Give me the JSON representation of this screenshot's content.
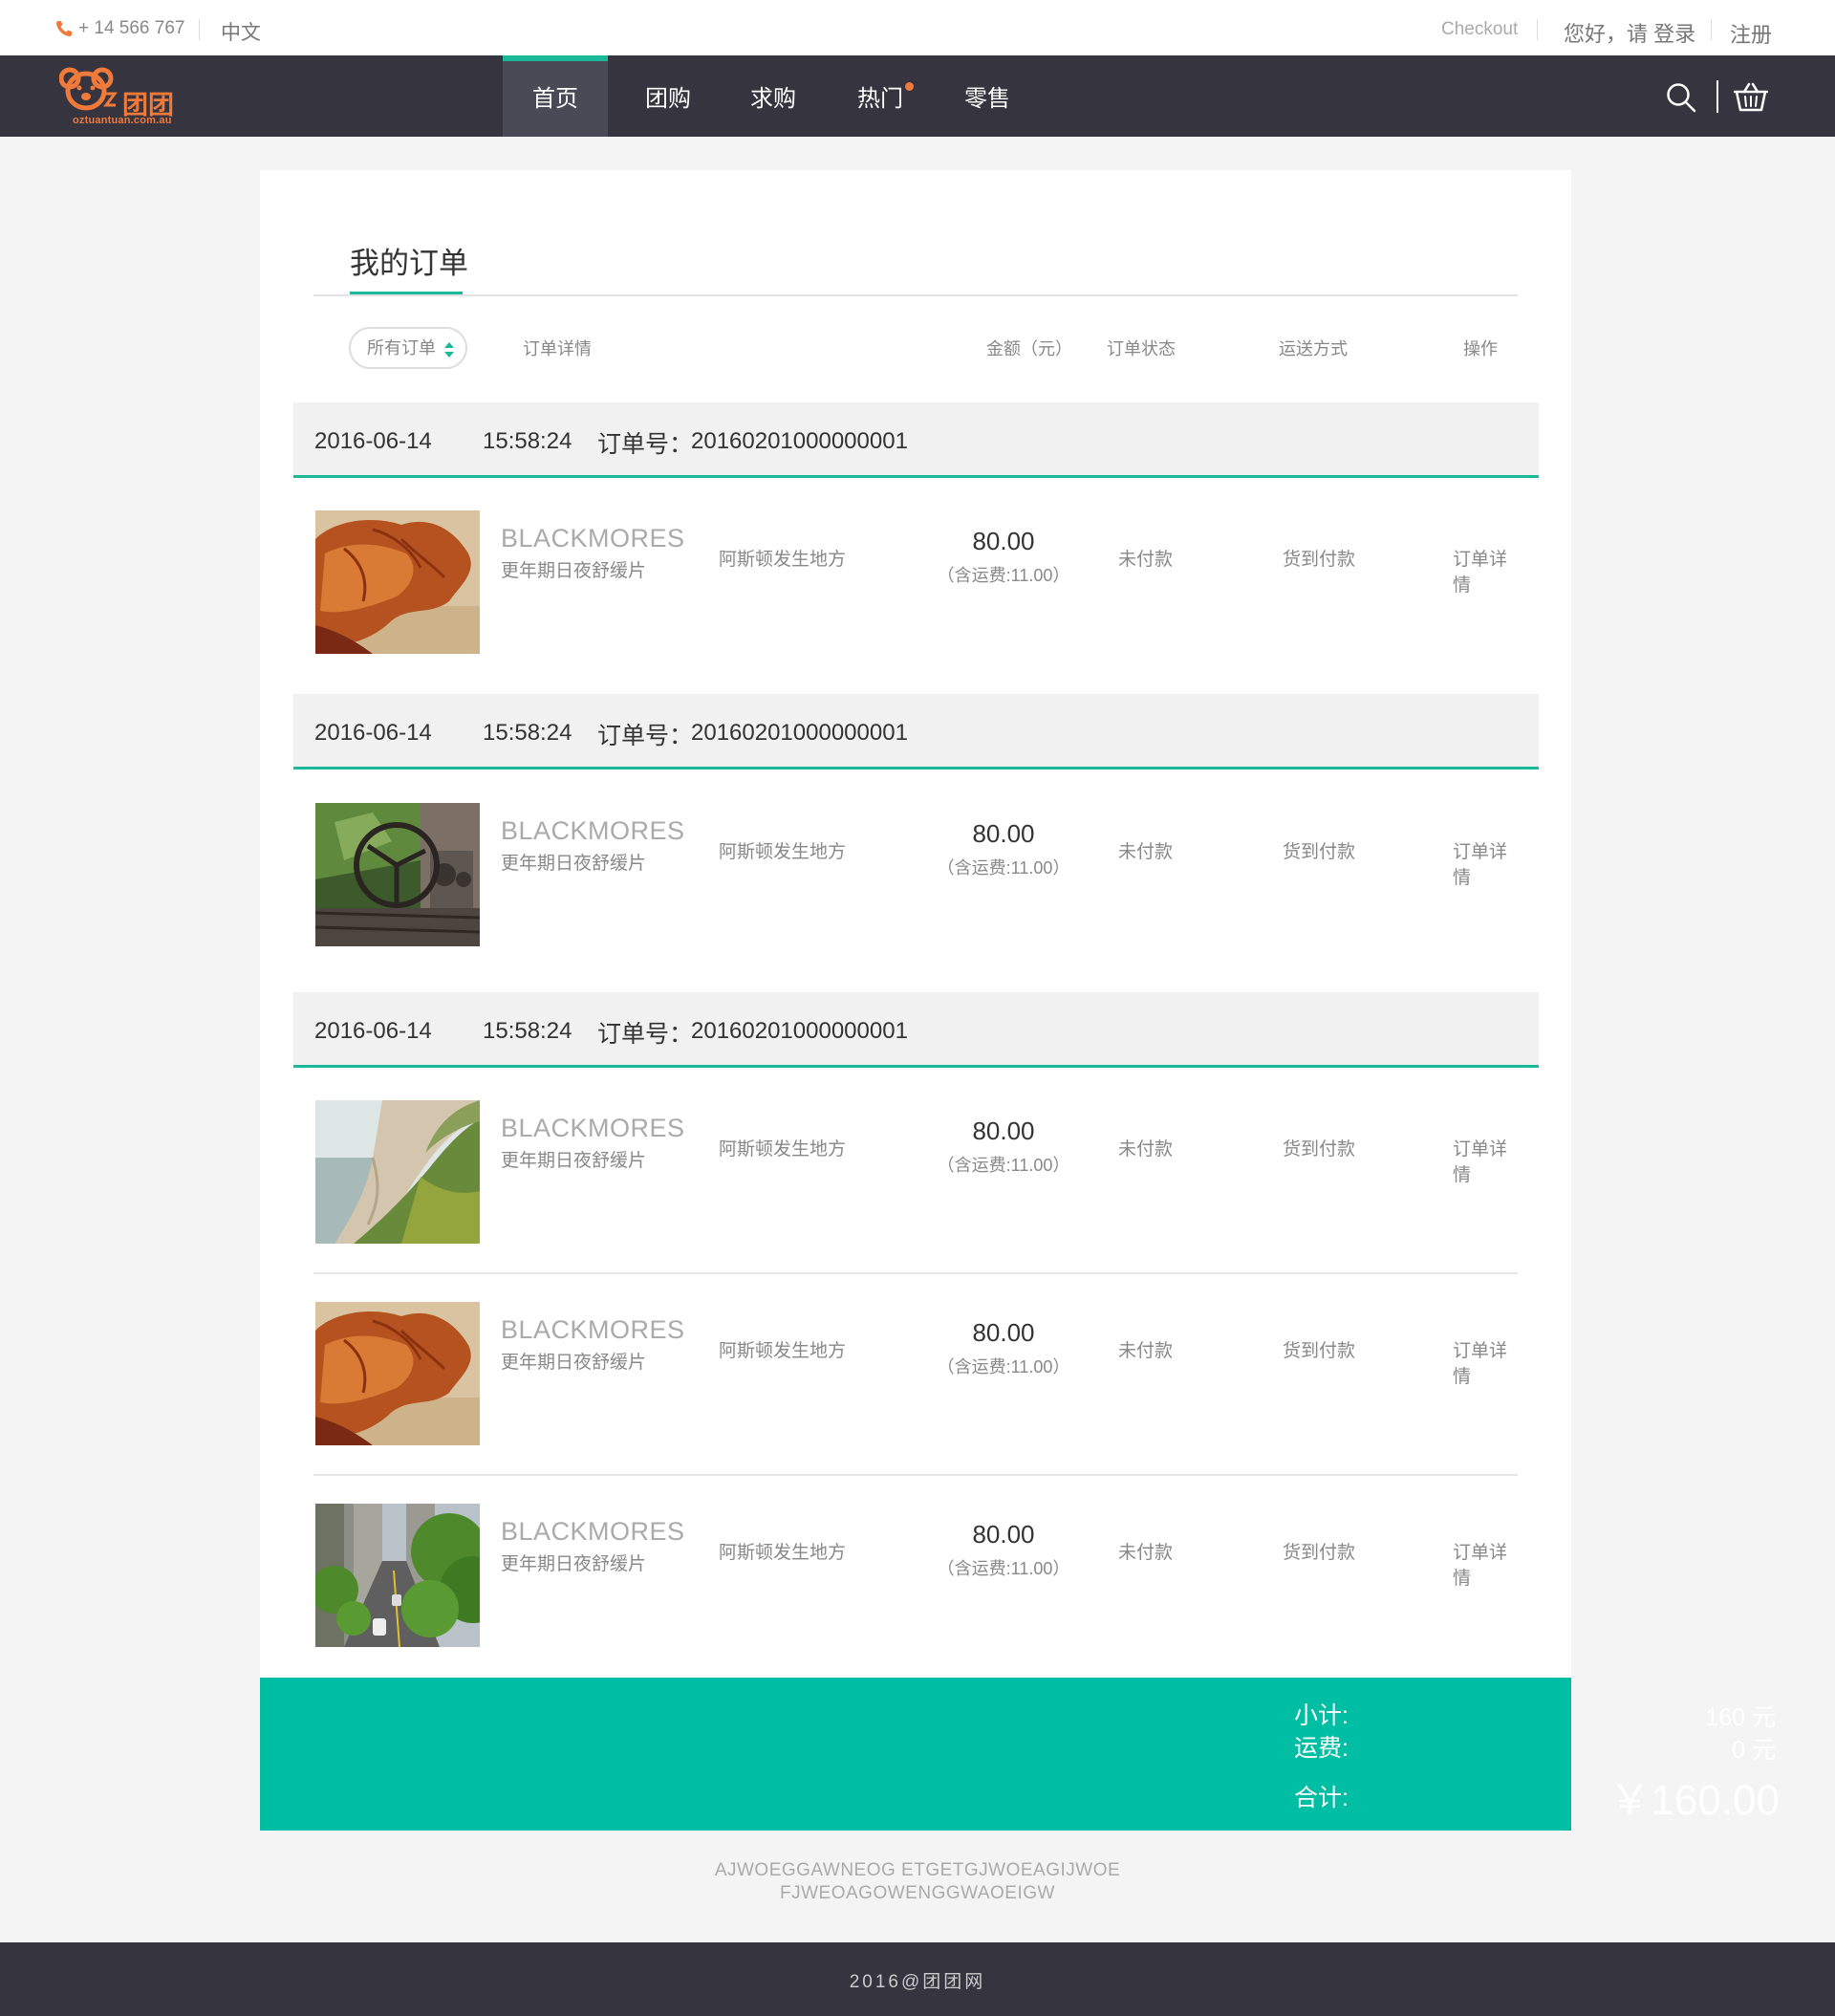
{
  "topbar": {
    "phone": "+ 14 566 767",
    "language": "中文",
    "checkout": "Checkout",
    "login": "您好，请 登录",
    "register": "注册"
  },
  "brand": {
    "name": "团团",
    "url": "oztuantuan.com.au",
    "accent_color": "#f07a3a"
  },
  "nav": {
    "items": [
      {
        "label": "首页"
      },
      {
        "label": "团购"
      },
      {
        "label": "求购"
      },
      {
        "label": "热门"
      },
      {
        "label": "零售"
      }
    ],
    "search_icon": "search-icon",
    "cart_icon": "basket-icon"
  },
  "page": {
    "title": "我的订单",
    "filter": "所有订单",
    "columns": {
      "details": "订单详情",
      "amount": "金额（元）",
      "status": "订单状态",
      "shipping": "运送方式",
      "action": "操作"
    }
  },
  "orders": [
    {
      "date": "2016-06-14",
      "time": "15:58:24",
      "number_label": "订单号：",
      "number": "20160201000000001",
      "items": [
        {
          "image": "highland-cow",
          "brand": "BLACKMORES",
          "desc": "更年期日夜舒缓片",
          "address": "阿斯顿发生地方",
          "price": "80.00",
          "shipping_fee": "（含运费:11.00）",
          "status": "未付款",
          "method": "货到付款",
          "action": "订单详情"
        }
      ]
    },
    {
      "date": "2016-06-14",
      "time": "15:58:24",
      "number_label": "订单号：",
      "number": "20160201000000001",
      "items": [
        {
          "image": "old-car-steering-wheel",
          "brand": "BLACKMORES",
          "desc": "更年期日夜舒缓片",
          "address": "阿斯顿发生地方",
          "price": "80.00",
          "shipping_fee": "（含运费:11.00）",
          "status": "未付款",
          "method": "货到付款",
          "action": "订单详情"
        }
      ]
    },
    {
      "date": "2016-06-14",
      "time": "15:58:24",
      "number_label": "订单号：",
      "number": "20160201000000001",
      "items": [
        {
          "image": "cliff-coast",
          "brand": "BLACKMORES",
          "desc": "更年期日夜舒缓片",
          "address": "阿斯顿发生地方",
          "price": "80.00",
          "shipping_fee": "（含运费:11.00）",
          "status": "未付款",
          "method": "货到付款",
          "action": "订单详情"
        },
        {
          "image": "highland-cow",
          "brand": "BLACKMORES",
          "desc": "更年期日夜舒缓片",
          "address": "阿斯顿发生地方",
          "price": "80.00",
          "shipping_fee": "（含运费:11.00）",
          "status": "未付款",
          "method": "货到付款",
          "action": "订单详情"
        },
        {
          "image": "city-street",
          "brand": "BLACKMORES",
          "desc": "更年期日夜舒缓片",
          "address": "阿斯顿发生地方",
          "price": "80.00",
          "shipping_fee": "（含运费:11.00）",
          "status": "未付款",
          "method": "货到付款",
          "action": "订单详情"
        }
      ]
    }
  ],
  "totals": {
    "subtotal_label": "小计:",
    "subtotal_value": "160 元",
    "shipping_label": "运费:",
    "shipping_value": "0 元",
    "total_label": "合计:",
    "total_value": "￥160.00",
    "bar_color": "#00bea3"
  },
  "footer": {
    "line1": "AJWOEGGAWNEOG  ETGETGJWOEAGIJWOE",
    "line2": "FJWEOAGOWENGGWAOEIGW",
    "copyright": "2016@团团网"
  }
}
